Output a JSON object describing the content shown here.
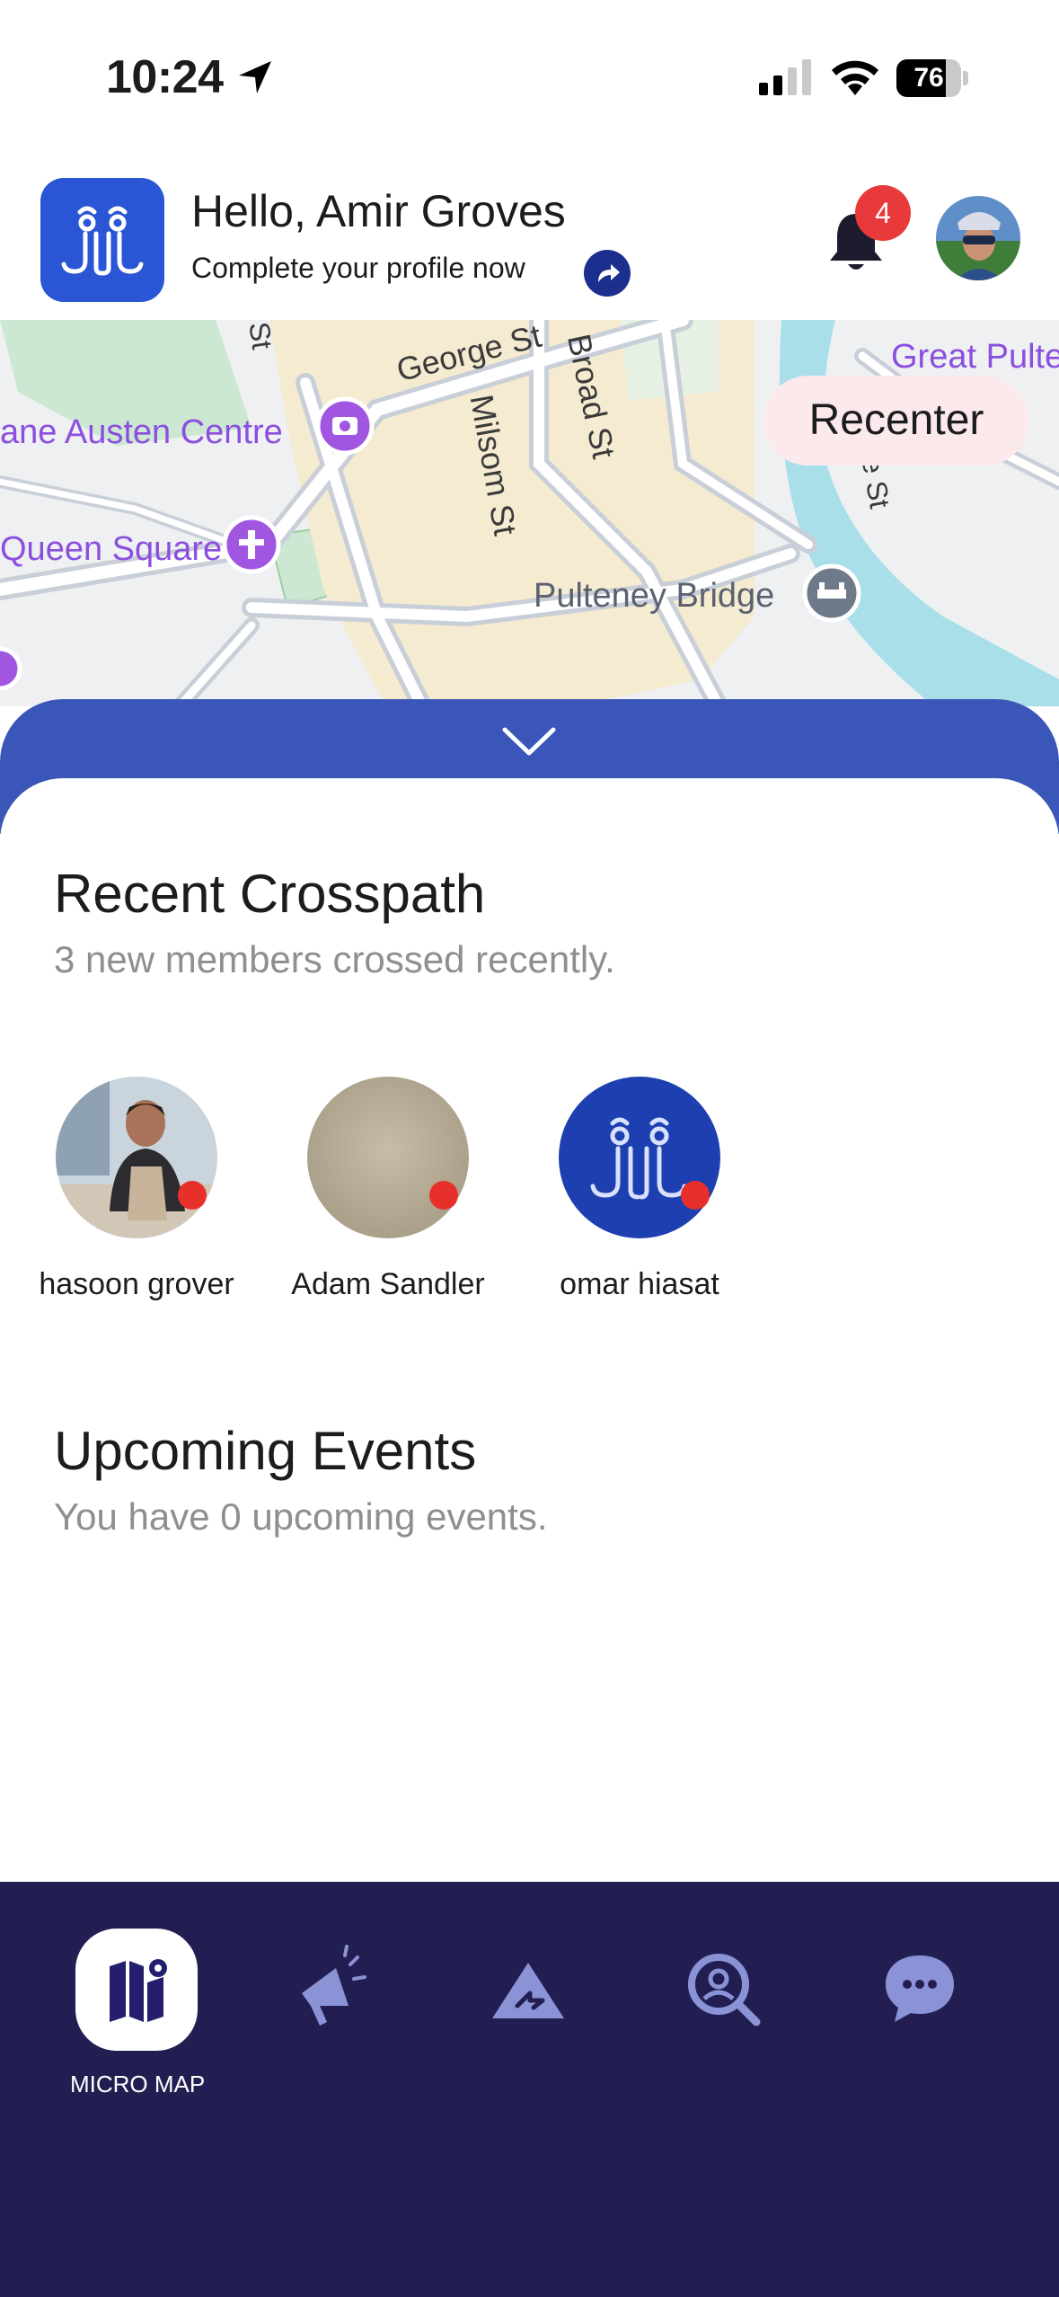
{
  "status_bar": {
    "time": "10:24",
    "battery": "76",
    "battery_level": 0.76,
    "icons": [
      "location-arrow-icon",
      "cellular-signal-icon",
      "wifi-icon",
      "battery-icon"
    ]
  },
  "header": {
    "greeting": "Hello, Amir Groves",
    "profile_cta": "Complete your profile now",
    "notification_count": "4",
    "brand_color": "#2a55d4"
  },
  "map": {
    "labels": {
      "george_st": "George St",
      "broad_st": "Broad St",
      "milsom_st": "Milsom St",
      "great_pulteney": "Great Pulte",
      "jane_austen": "ane Austen Centre",
      "queen_square": "Queen Square",
      "pulteney_bridge": "Pulteney Bridge",
      "st_top": "St",
      "e_st": "e St"
    },
    "recenter_label": "Recenter"
  },
  "recent_crosspath": {
    "title": "Recent Crosspath",
    "subtitle": "3 new members crossed recently.",
    "members": [
      {
        "name": "hasoon grover"
      },
      {
        "name": "Adam Sandler"
      },
      {
        "name": "omar hiasat"
      }
    ]
  },
  "upcoming_events": {
    "title": "Upcoming Events",
    "subtitle": "You have 0 upcoming events."
  },
  "tabbar": {
    "active_label": "MICRO MAP",
    "tabs": [
      "micro-map-icon",
      "megaphone-icon",
      "crosspath-icon",
      "search-user-icon",
      "chat-icon"
    ],
    "background": "#231e52",
    "icon_color": "#8a93d6"
  }
}
